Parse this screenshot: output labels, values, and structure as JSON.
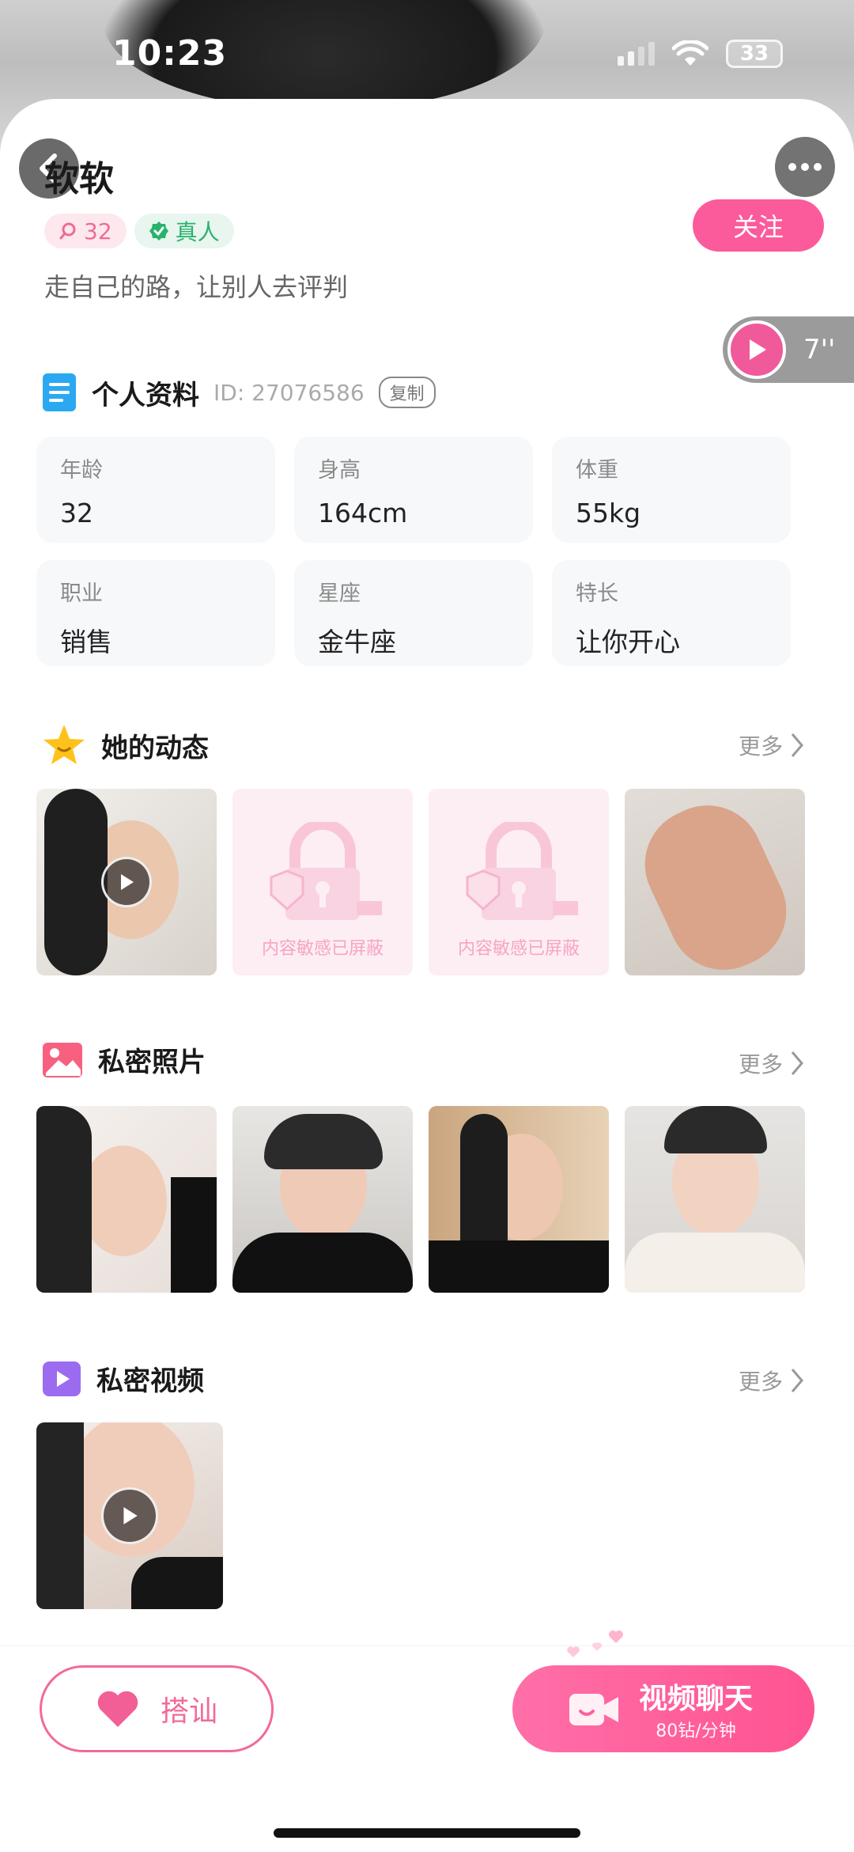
{
  "status_bar": {
    "time": "10:23",
    "battery": "33"
  },
  "profile": {
    "name": "软软",
    "popularity": "32",
    "verified_label": "真人",
    "bio": "走自己的路，让别人去评判",
    "follow_label": "关注",
    "voice_duration": "7''"
  },
  "personal_info": {
    "title": "个人资料",
    "id_text": "ID: 27076586",
    "copy_label": "复制",
    "fields": [
      {
        "label": "年龄",
        "value": "32"
      },
      {
        "label": "身高",
        "value": "164cm"
      },
      {
        "label": "体重",
        "value": "55kg"
      },
      {
        "label": "职业",
        "value": "销售"
      },
      {
        "label": "星座",
        "value": "金牛座"
      },
      {
        "label": "特长",
        "value": "让你开心"
      }
    ]
  },
  "moments": {
    "title": "她的动态",
    "more_label": "更多",
    "locked_text": "内容敏感已屏蔽"
  },
  "private_photos": {
    "title": "私密照片",
    "more_label": "更多"
  },
  "private_videos": {
    "title": "私密视频",
    "more_label": "更多"
  },
  "actions": {
    "greet_label": "搭讪",
    "video_chat_label": "视频聊天",
    "video_chat_price": "80钻/分钟"
  },
  "colors": {
    "accent": "#fb5b9b",
    "verified": "#27b36b"
  }
}
